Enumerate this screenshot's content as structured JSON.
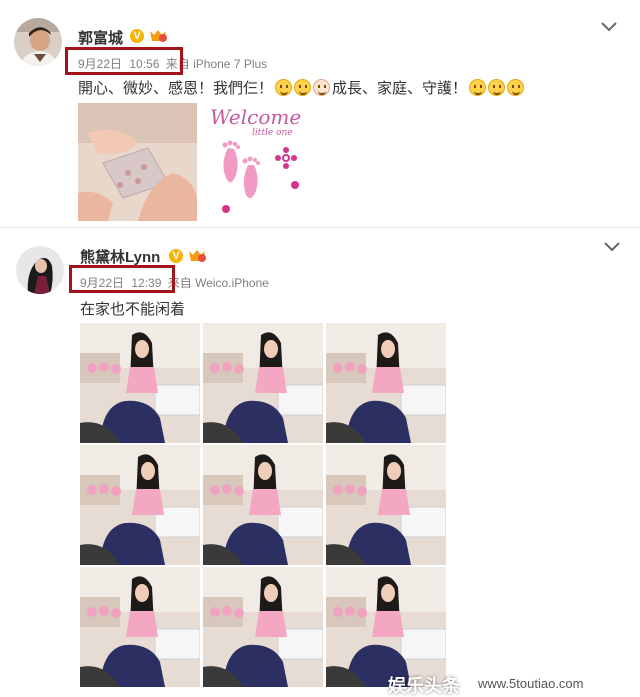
{
  "posts": [
    {
      "author": "郭富城",
      "date": "9月22日",
      "time": "10:56",
      "source_prefix": "来自",
      "source": "iPhone 7 Plus",
      "text_before": "開心、微妙、感恩！我們仨！",
      "text_middle": "成長、家庭、守護！",
      "welcome_title": "Welcome",
      "welcome_sub": "little one"
    },
    {
      "author": "熊黛林Lynn",
      "date": "9月22日",
      "time": "12:39",
      "source_prefix": "来自",
      "source": "Weico.iPhone",
      "text": "在家也不能闲着"
    }
  ],
  "watermark": {
    "brand": "娱乐头条",
    "url": "www.5toutiao.com"
  },
  "colors": {
    "highlight": "#a3141b",
    "meta": "#808080",
    "badge": "#f8b300"
  },
  "icons": [
    "chevron-down-icon",
    "verified-v-icon",
    "vip-icon"
  ]
}
